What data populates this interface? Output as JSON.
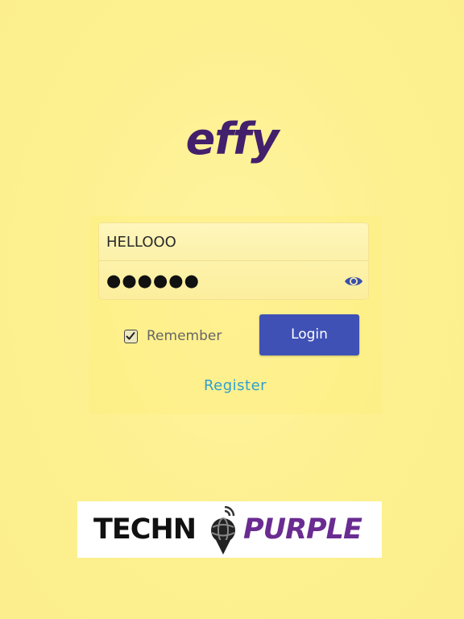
{
  "app": {
    "logo_text": "effy"
  },
  "login_form": {
    "username_value": "HELLOOO",
    "password_value": "●●●●●●",
    "show_password_icon": "eye-icon",
    "remember_label": "Remember",
    "remember_checked": true,
    "login_label": "Login",
    "register_label": "Register"
  },
  "branding": {
    "company_part1": "TECHN",
    "company_part2": "PURPLE",
    "emblem_icon": "globe-pin-icon"
  },
  "colors": {
    "background": "#fdf08f",
    "logo": "#43206c",
    "login_button": "#3f51b5",
    "register_link": "#2fa0d0",
    "brand_purple": "#6a2c91"
  }
}
